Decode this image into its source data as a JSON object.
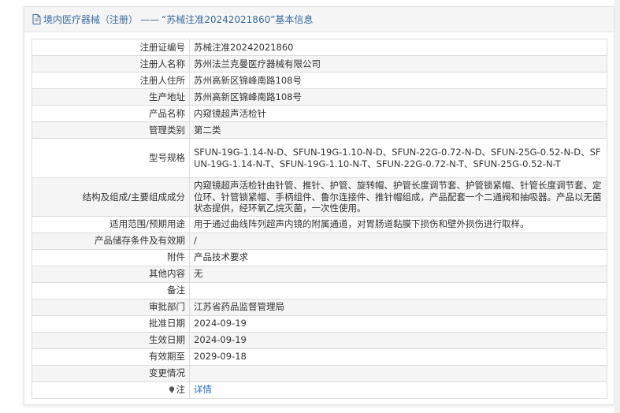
{
  "header": {
    "category": "境内医疗器械（注册）",
    "separator": "——",
    "title": "“苏械注准20242021860”基本信息"
  },
  "rows": [
    {
      "label": "注册证编号",
      "value": "苏械注准20242021860"
    },
    {
      "label": "注册人名称",
      "value": "苏州法兰克曼医疗器械有限公司"
    },
    {
      "label": "注册人住所",
      "value": "苏州高新区锦峰南路108号"
    },
    {
      "label": "生产地址",
      "value": "苏州高新区锦峰南路108号"
    },
    {
      "label": "产品名称",
      "value": "内窥镜超声活检针"
    },
    {
      "label": "管理类别",
      "value": "第二类"
    },
    {
      "label": "型号规格",
      "value": "SFUN-19G-1.14-N-D、SFUN-19G-1.10-N-D、SFUN-22G-0.72-N-D、SFUN-25G-0.52-N-D、SFUN-19G-1.14-N-T、SFUN-19G-1.10-N-T、SFUN-22G-0.72-N-T、SFUN-25G-0.52-N-T"
    },
    {
      "label": "结构及组成/主要组成成分",
      "value": "内窥镜超声活检针由针管、推针、护管、旋转帽、护管长度调节套、护管锁紧帽、针管长度调节套、定位环、针管锁紧帽、手柄组件、鲁尔连接件、推针帽组成，产品配套一个二通阀和抽吸器。产品以无菌状态提供，经环氧乙烷灭菌，一次性使用。"
    },
    {
      "label": "适用范围/预期用途",
      "value": "用于通过曲线阵列超声内镜的附属通道，对胃肠道黏膜下损伤和壁外损伤进行取样。"
    },
    {
      "label": "产品储存条件及有效期",
      "value": "/"
    },
    {
      "label": "附件",
      "value": "产品技术要求"
    },
    {
      "label": "其他内容",
      "value": "无"
    },
    {
      "label": "备注",
      "value": ""
    },
    {
      "label": "审批部门",
      "value": "江苏省药品监督管理局"
    },
    {
      "label": "批准日期",
      "value": "2024-09-19"
    },
    {
      "label": "生效日期",
      "value": "2024-09-19"
    },
    {
      "label": "有效期至",
      "value": "2029-09-18"
    },
    {
      "label": "变更情况",
      "value": ""
    }
  ],
  "note": {
    "label": "注",
    "link_text": "详情"
  },
  "icons": {
    "header": "document-icon",
    "note": "location-pin-icon"
  },
  "colors": {
    "header_text": "#3b6aa0",
    "link": "#2a6fc7",
    "stripe": "#f5f5f5"
  }
}
